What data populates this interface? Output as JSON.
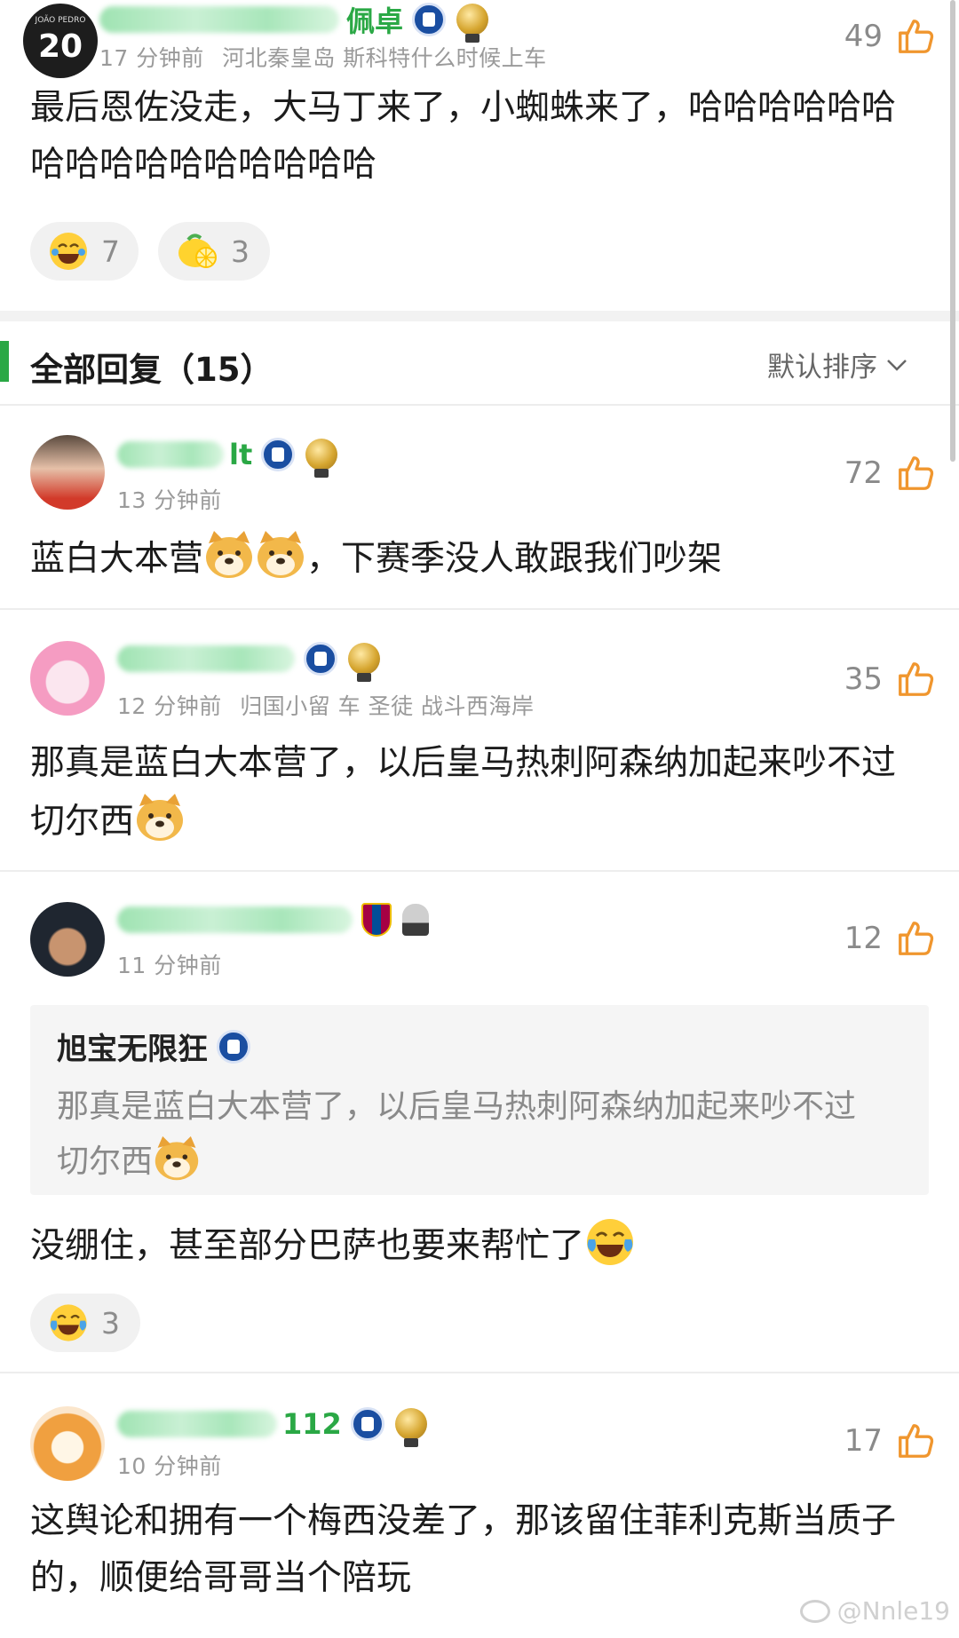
{
  "top_comment": {
    "name_suffix": "佩卓",
    "time": "17 分钟前",
    "meta_extra": "河北秦皇岛 斯科特什么时候上车",
    "likes": "49",
    "text": "最后恩佐没走，大马丁来了，小蜘蛛来了，哈哈哈哈哈哈哈哈哈哈哈哈哈哈哈哈",
    "reactions": [
      {
        "icon": "laughing-emoji-icon",
        "count": "7"
      },
      {
        "icon": "lemon-emoji-icon",
        "count": "3"
      }
    ],
    "avatar_number": "20",
    "avatar_caption": "JOÃO PEDRO"
  },
  "section": {
    "title": "全部回复（15）",
    "sort_label": "默认排序"
  },
  "comments": [
    {
      "name_suffix": "lt",
      "time": "13 分钟前",
      "likes": "72",
      "text_before": "蓝白大本营",
      "text_after": "，下赛季没人敢跟我们吵架"
    },
    {
      "name_suffix": "",
      "time": "12 分钟前",
      "meta_extra": "归国小留 车 圣徒 战斗西海岸",
      "likes": "35",
      "text": "那真是蓝白大本营了，以后皇马热刺阿森纳加起来吵不过切尔西"
    },
    {
      "name_suffix": "",
      "time": "11 分钟前",
      "likes": "12",
      "quoted_name": "旭宝无限狂",
      "quoted_text": "那真是蓝白大本营了，以后皇马热刺阿森纳加起来吵不过切尔西",
      "text": "没绷住，甚至部分巴萨也要来帮忙了",
      "reaction_count": "3"
    },
    {
      "name_suffix": "112",
      "time": "10 分钟前",
      "likes": "17",
      "text": "这舆论和拥有一个梅西没差了，那该留住菲利克斯当质子的，顺便给哥哥当个陪玩"
    }
  ],
  "watermark": "@Nnle19",
  "colors": {
    "name_green": "#2aa845",
    "like_orange": "#f0962e",
    "section_bar": "#2aa845",
    "chelsea_blue": "#1a4ea1"
  }
}
